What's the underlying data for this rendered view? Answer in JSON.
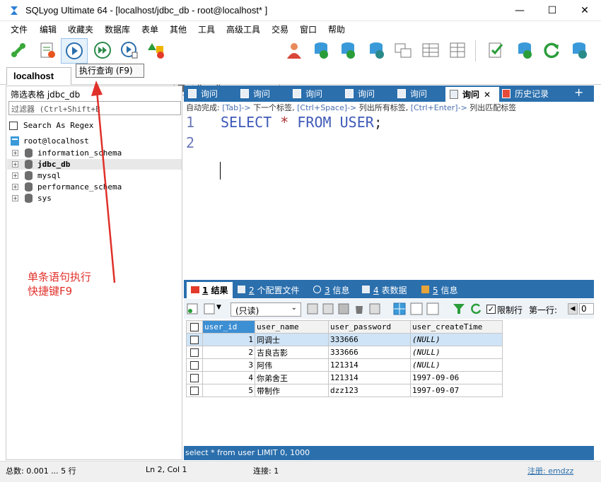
{
  "window": {
    "title": "SQLyog Ultimate 64 - [localhost/jdbc_db - root@localhost* ]",
    "minimize": "—",
    "maximize": "☐",
    "close": "✕"
  },
  "menu": [
    "文件",
    "编辑",
    "收藏夹",
    "数据库",
    "表单",
    "其他",
    "工具",
    "高级工具",
    "交易",
    "窗口",
    "帮助"
  ],
  "toolbar": {
    "db_select": "jdbc_db",
    "tooltip": "执行查询 (F9)"
  },
  "connection_tab": "localhost",
  "left_panel": {
    "title": "筛选表格 jdbc_db",
    "filter_placeholder": "过滤器 (Ctrl+Shift+B",
    "regex_label": "Search As Regex",
    "root": "root@localhost",
    "databases": [
      "information_schema",
      "jdbc_db",
      "mysql",
      "performance_schema",
      "sys"
    ],
    "active_db": "jdbc_db"
  },
  "annotation": {
    "line1": "单条语句执行",
    "line2": "快捷键F9",
    "color": "#e0302a"
  },
  "query_tabs": [
    "询问",
    "询问",
    "询问",
    "询问",
    "询问",
    "询问"
  ],
  "active_tab": "询问",
  "history_tab": "历史记录",
  "add_tab": "+",
  "hint": {
    "prefix": "自动完成:",
    "k1": "[Tab]->",
    "t1": "下一个标签,",
    "k2": "[Ctrl+Space]->",
    "t2": "列出所有标签,",
    "k3": "[Ctrl+Enter]->",
    "t3": "列出匹配标签"
  },
  "editor": {
    "line1": "1",
    "line2": "2",
    "kw1": "SELECT",
    "star": "*",
    "kw2": "FROM",
    "kw3": "USER",
    "semi": ";"
  },
  "result_tabs": [
    {
      "num": "1",
      "label": "结果"
    },
    {
      "num": "2",
      "label": "个配置文件"
    },
    {
      "num": "3",
      "label": "信息"
    },
    {
      "num": "4",
      "label": "表数据"
    },
    {
      "num": "5",
      "label": "信息"
    }
  ],
  "result_toolbar": {
    "mode": "(只读)",
    "limit_label": "限制行",
    "first_row_label": "第一行:",
    "first_row_value": "0"
  },
  "grid": {
    "columns": [
      "user_id",
      "user_name",
      "user_password",
      "user_createTime"
    ],
    "rows": [
      [
        "1",
        "同调士",
        "333666",
        "(NULL)"
      ],
      [
        "2",
        "吉良吉影",
        "333666",
        "(NULL)"
      ],
      [
        "3",
        "阿伟",
        "121314",
        "(NULL)"
      ],
      [
        "4",
        "你弟舍王",
        "121314",
        "1997-09-06"
      ],
      [
        "5",
        "带制作",
        "dzz123",
        "1997-09-07"
      ]
    ]
  },
  "sql_status": "select * from user LIMIT 0, 1000",
  "status": {
    "total": "总数: 0.001 ... 5 行",
    "position": "Ln 2, Col 1",
    "connection": "连接: 1",
    "register": "注册:  emdzz"
  }
}
